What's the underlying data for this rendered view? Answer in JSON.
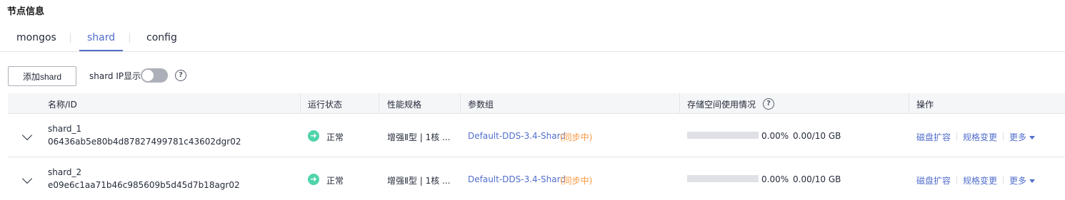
{
  "section_title": "节点信息",
  "tabs": [
    {
      "label": "mongos",
      "active": false
    },
    {
      "label": "shard",
      "active": true
    },
    {
      "label": "config",
      "active": false
    }
  ],
  "toolbar": {
    "add_button": "添加shard",
    "ip_toggle_label": "shard IP显示",
    "ip_toggle_on": false,
    "help_glyph": "?"
  },
  "table": {
    "columns": [
      "名称/ID",
      "运行状态",
      "性能规格",
      "参数组",
      "存储空间使用情况",
      "操作"
    ],
    "rows": [
      {
        "name": "shard_1",
        "id": "06436ab5e80b4d87827499781c43602dgr02",
        "status": "正常",
        "spec": "增强Ⅱ型 | 1核 ...",
        "param_group": "Default-DDS-3.4-Shard",
        "sync_status": "(同步中)",
        "usage_fraction": 0.0,
        "usage_pct": "0.00%",
        "capacity": "0.00/10 GB",
        "actions": [
          "磁盘扩容",
          "规格变更",
          "更多"
        ]
      },
      {
        "name": "shard_2",
        "id": "e09e6c1aa71b46c985609b5d45d7b18agr02",
        "status": "正常",
        "spec": "增强Ⅱ型 | 1核 ...",
        "param_group": "Default-DDS-3.4-Shard",
        "sync_status": "(同步中)",
        "usage_fraction": 0.0,
        "usage_pct": "0.00%",
        "capacity": "0.00/10 GB",
        "actions": [
          "磁盘扩容",
          "规格变更",
          "更多"
        ]
      }
    ]
  },
  "icons": {
    "status_ok": "check-circle-icon",
    "help": "question-circle-icon",
    "expand": "chevron-down-icon",
    "more": "caret-down-icon"
  },
  "colors": {
    "accent": "#526ecc",
    "status_ok": "#50d4ab",
    "sync_warning": "#fa9841",
    "header_bg": "#f5f6f8"
  }
}
